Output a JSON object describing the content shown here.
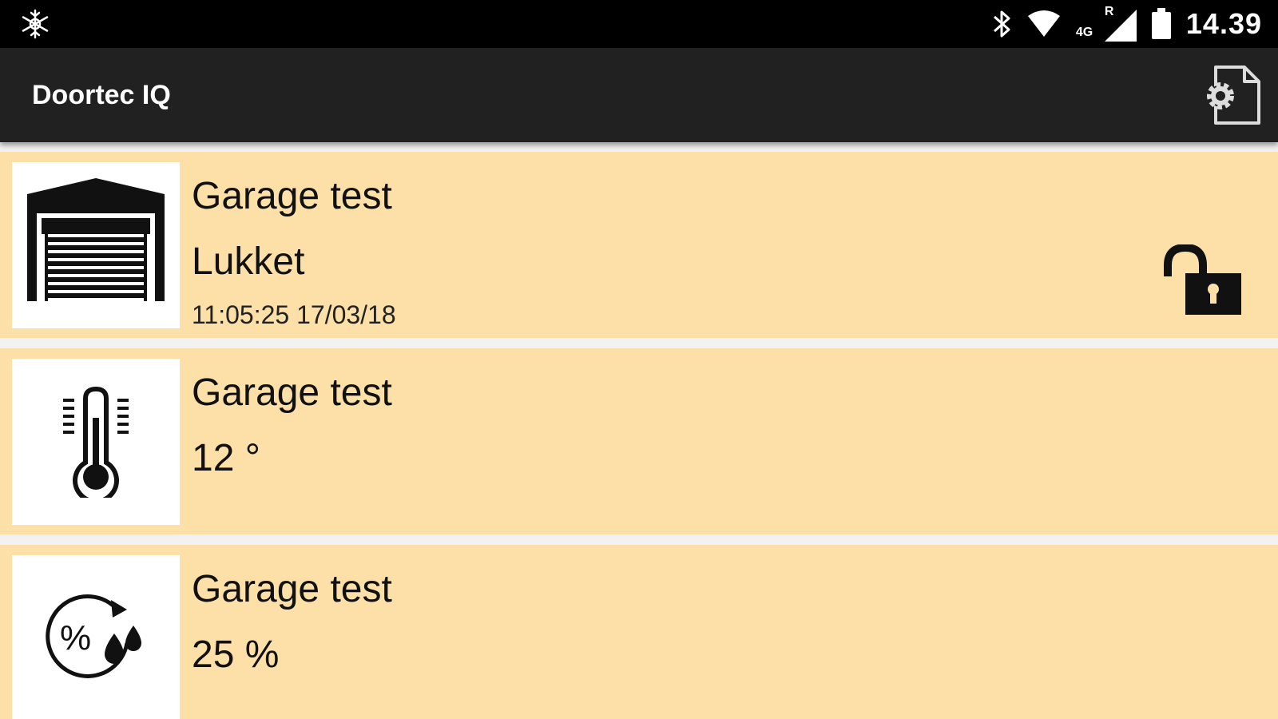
{
  "status_bar": {
    "left_icon": "snowflake-icon",
    "network_label": "4G",
    "roaming_label": "R",
    "clock": "14.39"
  },
  "app_bar": {
    "title": "Doortec IQ",
    "settings_icon": "settings-document-icon"
  },
  "devices": [
    {
      "icon": "garage-door-icon",
      "name": "Garage test",
      "value": "Lukket",
      "timestamp": "11:05:25  17/03/18",
      "action_icon": "unlock-icon"
    },
    {
      "icon": "thermometer-icon",
      "name": "Garage test",
      "value": "12 °"
    },
    {
      "icon": "humidity-icon",
      "name": "Garage test",
      "value": "25 %"
    }
  ],
  "colors": {
    "card_background": "#fce0a8",
    "app_bar": "#212121",
    "status_bar": "#000000",
    "list_background": "#f2f2f2"
  }
}
